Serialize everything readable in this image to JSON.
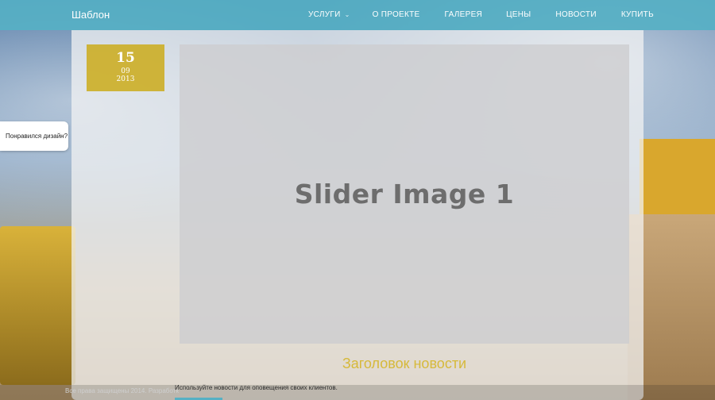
{
  "header": {
    "logo": "Шаблон",
    "nav": [
      {
        "label": "УСЛУГИ",
        "has_dropdown": true
      },
      {
        "label": "О ПРОЕКТЕ"
      },
      {
        "label": "ГАЛЕРЕЯ"
      },
      {
        "label": "ЦЕНЫ"
      },
      {
        "label": "НОВОСТИ"
      },
      {
        "label": "КУПИТЬ"
      }
    ],
    "accent_color": "#56b0c4"
  },
  "post": {
    "date": {
      "day": "15",
      "month": "09",
      "year": "2013"
    },
    "slider_text": "Slider Image 1",
    "title": "Заголовок новости",
    "description": "Используйте новости для оповещения своих клиентов."
  },
  "side_tab": {
    "label": "Понравился дизайн?"
  },
  "footer": {
    "text": "Все права защищены 2014. Разработк"
  },
  "colors": {
    "date_badge": "#ccae26",
    "title": "#d6b93a"
  }
}
